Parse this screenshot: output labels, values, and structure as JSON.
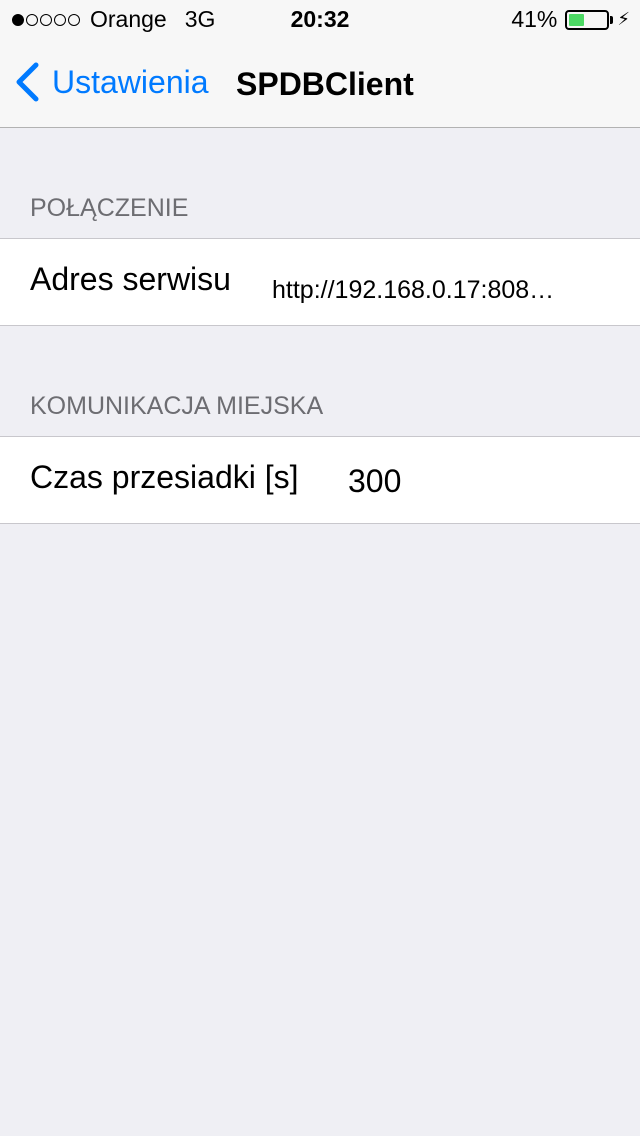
{
  "status_bar": {
    "carrier": "Orange",
    "network": "3G",
    "time": "20:32",
    "battery_percent": "41%",
    "battery_level": 0.41,
    "signal_bars_filled": 1,
    "signal_bars_total": 5
  },
  "nav": {
    "back_label": "Ustawienia",
    "title": "SPDBClient"
  },
  "sections": [
    {
      "header": "POŁĄCZENIE",
      "row": {
        "label": "Adres serwisu",
        "value": "http://192.168.0.17:808…"
      }
    },
    {
      "header": "KOMUNIKACJA MIEJSKA",
      "row": {
        "label": "Czas przesiadki [s]",
        "value": "300"
      }
    }
  ],
  "colors": {
    "accent": "#007aff",
    "background": "#efeff4",
    "battery": "#4cd964"
  }
}
